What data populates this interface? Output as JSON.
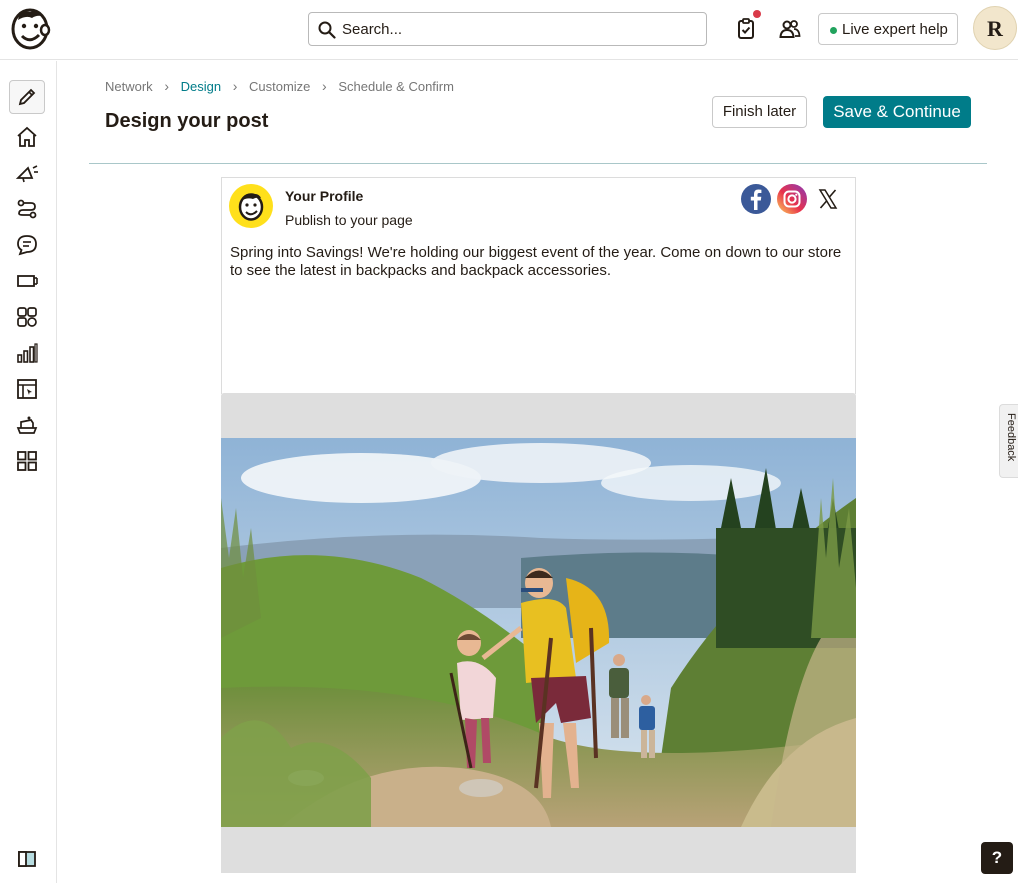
{
  "header": {
    "search_placeholder": "Search...",
    "expert_help_label": "Live expert help",
    "avatar_initial": "R",
    "icons": [
      "mailchimp-logo-icon",
      "search-icon",
      "clipboard-check-icon",
      "users-icon"
    ],
    "notification_color": "#d93a49"
  },
  "sidebar": {
    "items": [
      {
        "icon": "pencil-icon",
        "active": true
      },
      {
        "icon": "home-icon"
      },
      {
        "icon": "megaphone-icon"
      },
      {
        "icon": "automation-icon"
      },
      {
        "icon": "chat-icon"
      },
      {
        "icon": "signup-form-icon"
      },
      {
        "icon": "audience-icon"
      },
      {
        "icon": "analytics-icon"
      },
      {
        "icon": "website-icon"
      },
      {
        "icon": "content-icon"
      },
      {
        "icon": "integrations-icon"
      }
    ],
    "bottom_icon": "panel-toggle-icon"
  },
  "breadcrumb": {
    "items": [
      "Network",
      "Design",
      "Customize",
      "Schedule & Confirm"
    ],
    "current_index": 1
  },
  "page": {
    "title": "Design your post",
    "finish_later_label": "Finish later",
    "save_continue_label": "Save & Continue",
    "accent_color": "#007c89"
  },
  "post": {
    "profile_name": "Your Profile",
    "profile_subtitle": "Publish to your page",
    "networks": [
      "facebook-icon",
      "instagram-icon",
      "x-icon"
    ],
    "text": "Spring into Savings! We're holding our biggest event of the year. Come on down to our store to see the latest in backpacks and backpack accessories."
  },
  "feedback_label": "Feedback",
  "help_label": "?"
}
